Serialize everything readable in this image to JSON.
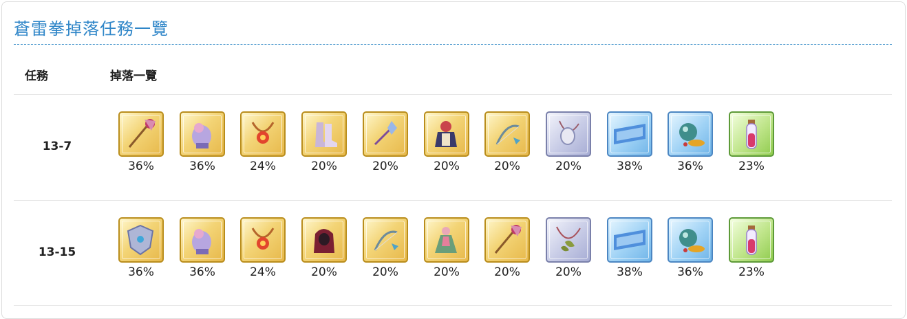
{
  "page": {
    "title": "蒼雷拳掉落任務一覽",
    "col_quest": "任務",
    "col_drops": "掉落一覽"
  },
  "colors": {
    "title": "#2f86c8",
    "frame_gold": "#b98d1c",
    "frame_silver": "#7a80aa",
    "frame_blue": "#4b86c2",
    "frame_green": "#5d9a38"
  },
  "rows": [
    {
      "quest": "13-7",
      "items": [
        {
          "icon": "staff-icon",
          "frame": "gold",
          "rate": "36%"
        },
        {
          "icon": "gauntlet-icon",
          "frame": "gold",
          "rate": "36%"
        },
        {
          "icon": "amulet-icon",
          "frame": "gold",
          "rate": "24%"
        },
        {
          "icon": "boots-icon",
          "frame": "gold",
          "rate": "20%"
        },
        {
          "icon": "wand-icon",
          "frame": "gold",
          "rate": "20%"
        },
        {
          "icon": "armor-icon",
          "frame": "gold",
          "rate": "20%"
        },
        {
          "icon": "bow-icon",
          "frame": "gold",
          "rate": "20%"
        },
        {
          "icon": "pendant-icon",
          "frame": "silver",
          "rate": "20%"
        },
        {
          "icon": "ticket-icon",
          "frame": "blue",
          "rate": "38%"
        },
        {
          "icon": "mana-pot-icon",
          "frame": "blue",
          "rate": "36%"
        },
        {
          "icon": "potion-vial-icon",
          "frame": "green",
          "rate": "23%"
        }
      ]
    },
    {
      "quest": "13-15",
      "items": [
        {
          "icon": "shield-icon",
          "frame": "gold",
          "rate": "36%"
        },
        {
          "icon": "gauntlet-icon",
          "frame": "gold",
          "rate": "36%"
        },
        {
          "icon": "amulet-icon",
          "frame": "gold",
          "rate": "24%"
        },
        {
          "icon": "hood-icon",
          "frame": "gold",
          "rate": "20%"
        },
        {
          "icon": "bow-icon",
          "frame": "gold",
          "rate": "20%"
        },
        {
          "icon": "dress-icon",
          "frame": "gold",
          "rate": "20%"
        },
        {
          "icon": "staff-icon",
          "frame": "gold",
          "rate": "20%"
        },
        {
          "icon": "leaf-necklace-icon",
          "frame": "silver",
          "rate": "20%"
        },
        {
          "icon": "ticket-icon",
          "frame": "blue",
          "rate": "38%"
        },
        {
          "icon": "mana-pot-icon",
          "frame": "blue",
          "rate": "36%"
        },
        {
          "icon": "potion-vial-icon",
          "frame": "green",
          "rate": "23%"
        }
      ]
    }
  ]
}
